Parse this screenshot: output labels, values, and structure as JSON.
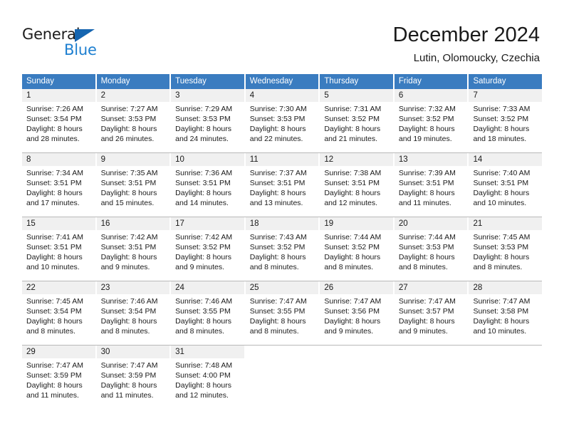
{
  "brand": {
    "name_part1": "General",
    "name_part2": "Blue",
    "triangle_color": "#1565b0",
    "blue_color": "#1d7fd0"
  },
  "header": {
    "title": "December 2024",
    "subtitle": "Lutin, Olomoucky, Czechia"
  },
  "theme": {
    "header_band": "#3a7cc0",
    "daynum_band": "#f0f0f0",
    "row_divider": "#b9b9b9"
  },
  "weekdays": [
    "Sunday",
    "Monday",
    "Tuesday",
    "Wednesday",
    "Thursday",
    "Friday",
    "Saturday"
  ],
  "weeks": [
    [
      {
        "day": "1",
        "sunrise": "Sunrise: 7:26 AM",
        "sunset": "Sunset: 3:54 PM",
        "daylight_line1": "Daylight: 8 hours",
        "daylight_line2": "and 28 minutes."
      },
      {
        "day": "2",
        "sunrise": "Sunrise: 7:27 AM",
        "sunset": "Sunset: 3:53 PM",
        "daylight_line1": "Daylight: 8 hours",
        "daylight_line2": "and 26 minutes."
      },
      {
        "day": "3",
        "sunrise": "Sunrise: 7:29 AM",
        "sunset": "Sunset: 3:53 PM",
        "daylight_line1": "Daylight: 8 hours",
        "daylight_line2": "and 24 minutes."
      },
      {
        "day": "4",
        "sunrise": "Sunrise: 7:30 AM",
        "sunset": "Sunset: 3:53 PM",
        "daylight_line1": "Daylight: 8 hours",
        "daylight_line2": "and 22 minutes."
      },
      {
        "day": "5",
        "sunrise": "Sunrise: 7:31 AM",
        "sunset": "Sunset: 3:52 PM",
        "daylight_line1": "Daylight: 8 hours",
        "daylight_line2": "and 21 minutes."
      },
      {
        "day": "6",
        "sunrise": "Sunrise: 7:32 AM",
        "sunset": "Sunset: 3:52 PM",
        "daylight_line1": "Daylight: 8 hours",
        "daylight_line2": "and 19 minutes."
      },
      {
        "day": "7",
        "sunrise": "Sunrise: 7:33 AM",
        "sunset": "Sunset: 3:52 PM",
        "daylight_line1": "Daylight: 8 hours",
        "daylight_line2": "and 18 minutes."
      }
    ],
    [
      {
        "day": "8",
        "sunrise": "Sunrise: 7:34 AM",
        "sunset": "Sunset: 3:51 PM",
        "daylight_line1": "Daylight: 8 hours",
        "daylight_line2": "and 17 minutes."
      },
      {
        "day": "9",
        "sunrise": "Sunrise: 7:35 AM",
        "sunset": "Sunset: 3:51 PM",
        "daylight_line1": "Daylight: 8 hours",
        "daylight_line2": "and 15 minutes."
      },
      {
        "day": "10",
        "sunrise": "Sunrise: 7:36 AM",
        "sunset": "Sunset: 3:51 PM",
        "daylight_line1": "Daylight: 8 hours",
        "daylight_line2": "and 14 minutes."
      },
      {
        "day": "11",
        "sunrise": "Sunrise: 7:37 AM",
        "sunset": "Sunset: 3:51 PM",
        "daylight_line1": "Daylight: 8 hours",
        "daylight_line2": "and 13 minutes."
      },
      {
        "day": "12",
        "sunrise": "Sunrise: 7:38 AM",
        "sunset": "Sunset: 3:51 PM",
        "daylight_line1": "Daylight: 8 hours",
        "daylight_line2": "and 12 minutes."
      },
      {
        "day": "13",
        "sunrise": "Sunrise: 7:39 AM",
        "sunset": "Sunset: 3:51 PM",
        "daylight_line1": "Daylight: 8 hours",
        "daylight_line2": "and 11 minutes."
      },
      {
        "day": "14",
        "sunrise": "Sunrise: 7:40 AM",
        "sunset": "Sunset: 3:51 PM",
        "daylight_line1": "Daylight: 8 hours",
        "daylight_line2": "and 10 minutes."
      }
    ],
    [
      {
        "day": "15",
        "sunrise": "Sunrise: 7:41 AM",
        "sunset": "Sunset: 3:51 PM",
        "daylight_line1": "Daylight: 8 hours",
        "daylight_line2": "and 10 minutes."
      },
      {
        "day": "16",
        "sunrise": "Sunrise: 7:42 AM",
        "sunset": "Sunset: 3:51 PM",
        "daylight_line1": "Daylight: 8 hours",
        "daylight_line2": "and 9 minutes."
      },
      {
        "day": "17",
        "sunrise": "Sunrise: 7:42 AM",
        "sunset": "Sunset: 3:52 PM",
        "daylight_line1": "Daylight: 8 hours",
        "daylight_line2": "and 9 minutes."
      },
      {
        "day": "18",
        "sunrise": "Sunrise: 7:43 AM",
        "sunset": "Sunset: 3:52 PM",
        "daylight_line1": "Daylight: 8 hours",
        "daylight_line2": "and 8 minutes."
      },
      {
        "day": "19",
        "sunrise": "Sunrise: 7:44 AM",
        "sunset": "Sunset: 3:52 PM",
        "daylight_line1": "Daylight: 8 hours",
        "daylight_line2": "and 8 minutes."
      },
      {
        "day": "20",
        "sunrise": "Sunrise: 7:44 AM",
        "sunset": "Sunset: 3:53 PM",
        "daylight_line1": "Daylight: 8 hours",
        "daylight_line2": "and 8 minutes."
      },
      {
        "day": "21",
        "sunrise": "Sunrise: 7:45 AM",
        "sunset": "Sunset: 3:53 PM",
        "daylight_line1": "Daylight: 8 hours",
        "daylight_line2": "and 8 minutes."
      }
    ],
    [
      {
        "day": "22",
        "sunrise": "Sunrise: 7:45 AM",
        "sunset": "Sunset: 3:54 PM",
        "daylight_line1": "Daylight: 8 hours",
        "daylight_line2": "and 8 minutes."
      },
      {
        "day": "23",
        "sunrise": "Sunrise: 7:46 AM",
        "sunset": "Sunset: 3:54 PM",
        "daylight_line1": "Daylight: 8 hours",
        "daylight_line2": "and 8 minutes."
      },
      {
        "day": "24",
        "sunrise": "Sunrise: 7:46 AM",
        "sunset": "Sunset: 3:55 PM",
        "daylight_line1": "Daylight: 8 hours",
        "daylight_line2": "and 8 minutes."
      },
      {
        "day": "25",
        "sunrise": "Sunrise: 7:47 AM",
        "sunset": "Sunset: 3:55 PM",
        "daylight_line1": "Daylight: 8 hours",
        "daylight_line2": "and 8 minutes."
      },
      {
        "day": "26",
        "sunrise": "Sunrise: 7:47 AM",
        "sunset": "Sunset: 3:56 PM",
        "daylight_line1": "Daylight: 8 hours",
        "daylight_line2": "and 9 minutes."
      },
      {
        "day": "27",
        "sunrise": "Sunrise: 7:47 AM",
        "sunset": "Sunset: 3:57 PM",
        "daylight_line1": "Daylight: 8 hours",
        "daylight_line2": "and 9 minutes."
      },
      {
        "day": "28",
        "sunrise": "Sunrise: 7:47 AM",
        "sunset": "Sunset: 3:58 PM",
        "daylight_line1": "Daylight: 8 hours",
        "daylight_line2": "and 10 minutes."
      }
    ],
    [
      {
        "day": "29",
        "sunrise": "Sunrise: 7:47 AM",
        "sunset": "Sunset: 3:59 PM",
        "daylight_line1": "Daylight: 8 hours",
        "daylight_line2": "and 11 minutes."
      },
      {
        "day": "30",
        "sunrise": "Sunrise: 7:47 AM",
        "sunset": "Sunset: 3:59 PM",
        "daylight_line1": "Daylight: 8 hours",
        "daylight_line2": "and 11 minutes."
      },
      {
        "day": "31",
        "sunrise": "Sunrise: 7:48 AM",
        "sunset": "Sunset: 4:00 PM",
        "daylight_line1": "Daylight: 8 hours",
        "daylight_line2": "and 12 minutes."
      },
      {
        "day": "",
        "sunrise": "",
        "sunset": "",
        "daylight_line1": "",
        "daylight_line2": ""
      },
      {
        "day": "",
        "sunrise": "",
        "sunset": "",
        "daylight_line1": "",
        "daylight_line2": ""
      },
      {
        "day": "",
        "sunrise": "",
        "sunset": "",
        "daylight_line1": "",
        "daylight_line2": ""
      },
      {
        "day": "",
        "sunrise": "",
        "sunset": "",
        "daylight_line1": "",
        "daylight_line2": ""
      }
    ]
  ]
}
